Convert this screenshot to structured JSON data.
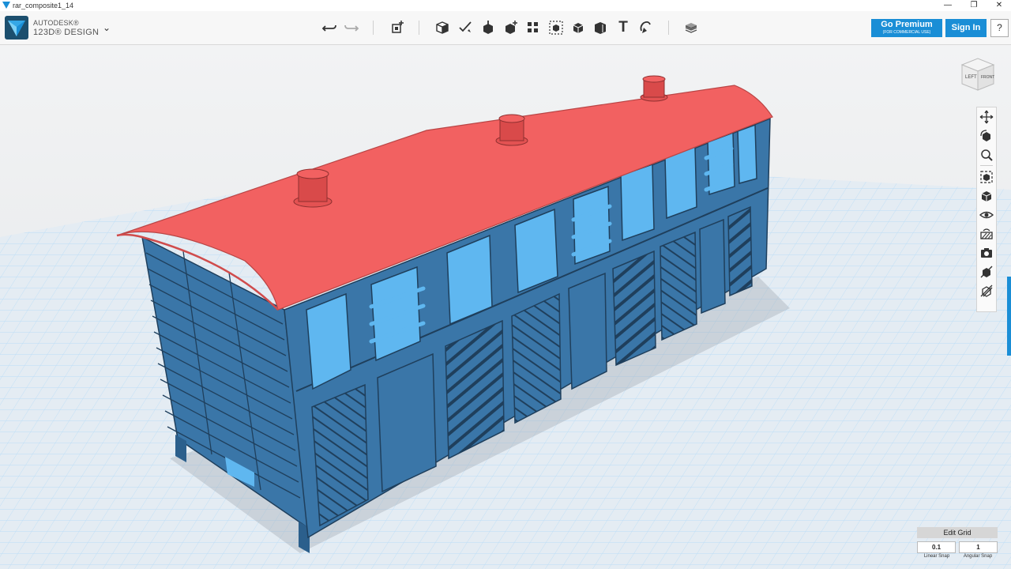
{
  "window": {
    "title": "rar_composite1_14",
    "minimize": "—",
    "maximize": "❐",
    "close": "✕"
  },
  "brand": {
    "line1": "AUTODESK®",
    "line2": "123D® DESIGN",
    "menu_glyph": "⌄"
  },
  "toolbar": {
    "tools": [
      {
        "name": "undo-icon"
      },
      {
        "name": "redo-icon"
      },
      {
        "name": "transform-icon"
      },
      {
        "name": "primitives-icon"
      },
      {
        "name": "sketch-icon"
      },
      {
        "name": "construct-icon"
      },
      {
        "name": "modify-icon"
      },
      {
        "name": "pattern-icon"
      },
      {
        "name": "grouping-icon"
      },
      {
        "name": "combine-icon"
      },
      {
        "name": "measure-icon"
      },
      {
        "name": "text-icon"
      },
      {
        "name": "snap-icon"
      },
      {
        "name": "material-icon"
      }
    ],
    "text_tool_glyph": "T"
  },
  "premium": {
    "label": "Go Premium",
    "sublabel": "(FOR COMMERCIAL USE)"
  },
  "signin": {
    "label": "Sign In"
  },
  "help": {
    "label": "?"
  },
  "viewcube": {
    "left_label": "LEFT",
    "front_label": "FRONT"
  },
  "navbar": {
    "items": [
      "pan-icon",
      "orbit-icon",
      "zoom-icon",
      "fit-icon",
      "views-icon",
      "visibility-icon",
      "material-display-icon",
      "screenshot-icon",
      "hide-icon",
      "hide-all-icon"
    ]
  },
  "grid": {
    "title": "Edit Grid",
    "linear_value": "0.1",
    "angular_value": "1",
    "linear_label": "Linear Snap",
    "angular_label": "Angular Snap"
  },
  "colors": {
    "accent": "#1a8ed6",
    "body": "#3a76a8",
    "body_dark": "#2b5f8c",
    "window": "#5fb7f0",
    "roof": "#f26161",
    "grid_bg": "#dde6ee",
    "grid_line": "#b9dcf6"
  }
}
